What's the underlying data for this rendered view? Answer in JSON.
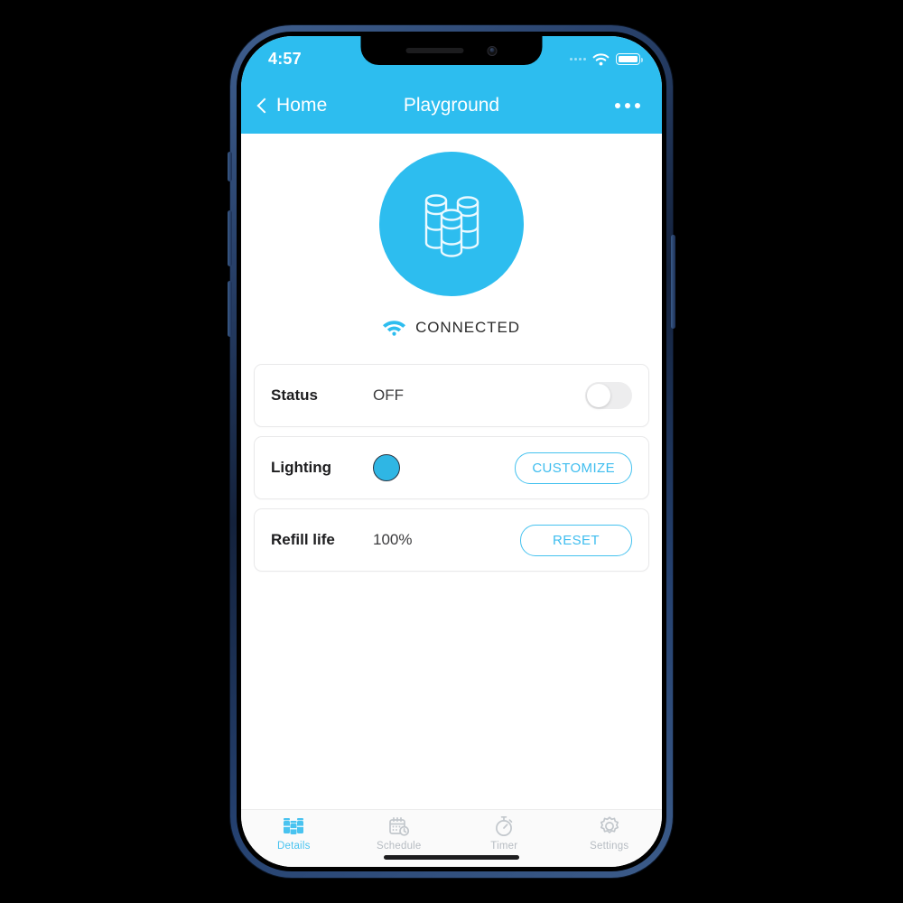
{
  "status_bar": {
    "time": "4:57",
    "wifi_icon": "wifi-icon",
    "battery_icon": "battery-full-icon",
    "signal_icon": "signal-dots-icon"
  },
  "nav": {
    "back_label": "Home",
    "back_icon": "chevron-left-icon",
    "title": "Playground",
    "more_icon": "more-options-icon"
  },
  "hero": {
    "device_icon": "diffuser-refills-icon",
    "connection_icon": "wifi-icon",
    "connection_status": "CONNECTED"
  },
  "rows": [
    {
      "label": "Status",
      "value": "OFF",
      "control": "toggle",
      "toggle_state": "off"
    },
    {
      "label": "Lighting",
      "value": "",
      "control": "color-swatch",
      "swatch_color": "#2fb6e4",
      "action_label": "CUSTOMIZE"
    },
    {
      "label": "Refill life",
      "value": "100%",
      "control": "none",
      "action_label": "RESET"
    }
  ],
  "tabs": [
    {
      "label": "Details",
      "icon": "refills-icon",
      "active": true
    },
    {
      "label": "Schedule",
      "icon": "calendar-clock-icon",
      "active": false
    },
    {
      "label": "Timer",
      "icon": "stopwatch-icon",
      "active": false
    },
    {
      "label": "Settings",
      "icon": "gear-icon",
      "active": false
    }
  ],
  "colors": {
    "brand_blue": "#2dbdef",
    "accent_blue": "#45c2ef",
    "tab_inactive": "#b6bcc2",
    "card_border": "#e9e9ea"
  }
}
